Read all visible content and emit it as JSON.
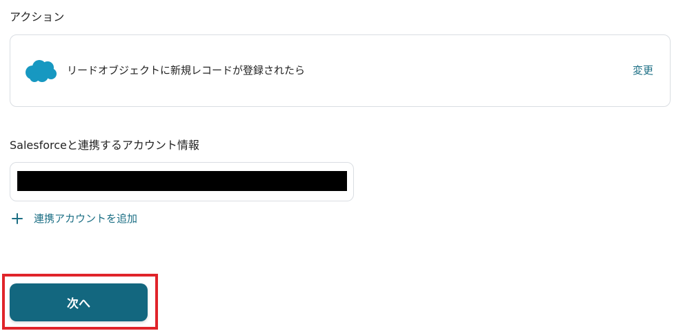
{
  "action_section": {
    "label": "アクション",
    "card": {
      "app_icon": "salesforce-cloud-icon",
      "trigger_text": "リードオブジェクトに新規レコードが登録されたら",
      "change_label": "変更"
    }
  },
  "account_section": {
    "label": "Salesforceと連携するアカウント情報",
    "add_account_label": "連携アカウントを追加",
    "add_icon": "plus-icon"
  },
  "next_button": {
    "label": "次へ"
  },
  "colors": {
    "accent": "#13677f",
    "link": "#1b6e84",
    "highlight": "#e0242a",
    "salesforce_blue": "#1798c1"
  }
}
